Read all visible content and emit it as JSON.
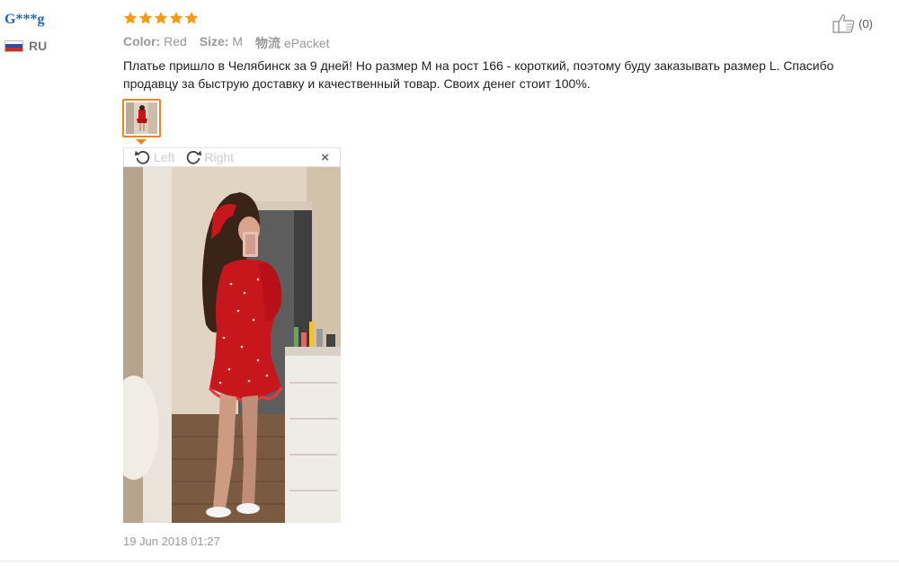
{
  "review": {
    "user": {
      "name": "G***g",
      "country_code": "RU"
    },
    "rating": {
      "stars": 5,
      "max": 5,
      "color": "#f79a0e"
    },
    "attributes": [
      {
        "label": "Color:",
        "value": "Red"
      },
      {
        "label": "Size:",
        "value": "M"
      },
      {
        "label": "物流",
        "value": "ePacket"
      }
    ],
    "helpful": {
      "count_text": "(0)",
      "icon": "thumbs-up-icon"
    },
    "text": "Платье пришло в Челябинск за 9 дней! Но размер M на рост 166 - короткий, поэтому буду заказывать размер L. Спасибо продавцу за быструю доставку и качественный товар. Своих денег стоит 100%.",
    "viewer": {
      "rotate_left_label": "Left",
      "rotate_right_label": "Right",
      "close_label": "×"
    },
    "date": "19 Jun 2018 01:27"
  },
  "colors": {
    "accent": "#f0841e",
    "username": "#1f66b6",
    "muted": "#999999"
  }
}
